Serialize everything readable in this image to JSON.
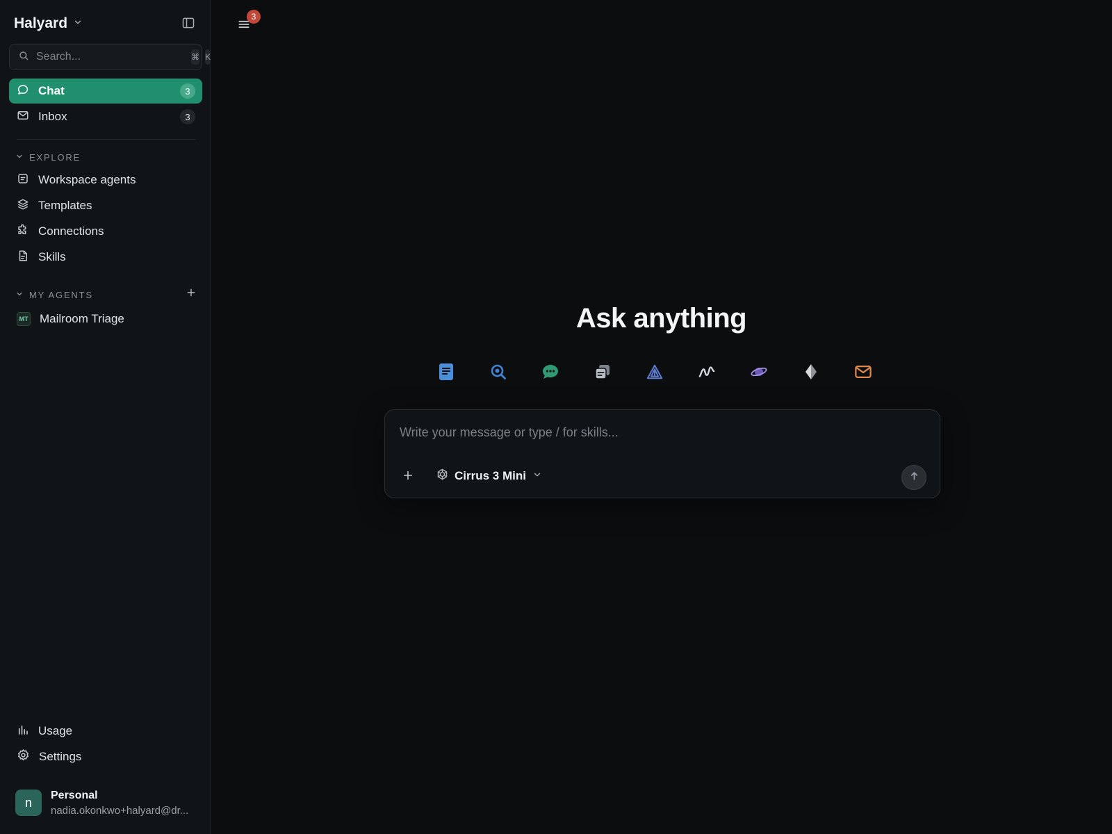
{
  "workspace": {
    "name": "Halyard"
  },
  "search": {
    "placeholder": "Search...",
    "shortcut_mod": "⌘",
    "shortcut_key": "K"
  },
  "nav": [
    {
      "label": "Chat",
      "count": "3",
      "icon": "chat-bubble-icon",
      "active": true
    },
    {
      "label": "Inbox",
      "count": "3",
      "icon": "mail-icon",
      "active": false
    }
  ],
  "explore": {
    "title": "EXPLORE",
    "items": [
      {
        "label": "Workspace agents",
        "icon": "agent-icon"
      },
      {
        "label": "Templates",
        "icon": "layers-icon"
      },
      {
        "label": "Connections",
        "icon": "puzzle-icon"
      },
      {
        "label": "Skills",
        "icon": "document-icon"
      }
    ]
  },
  "my_agents": {
    "title": "MY AGENTS",
    "items": [
      {
        "label": "Mailroom Triage",
        "initials": "MT"
      }
    ]
  },
  "footer": {
    "usage": "Usage",
    "settings": "Settings",
    "profile": {
      "name": "Personal",
      "email": "nadia.okonkwo+halyard@dr...",
      "initial": "n"
    }
  },
  "main": {
    "notifications": "3",
    "headline": "Ask anything",
    "tools": [
      "docs-icon",
      "search-icon",
      "chat-icon",
      "notes-icon",
      "triangle-icon",
      "signal-icon",
      "planet-icon",
      "diamond-icon",
      "mail-icon"
    ],
    "composer": {
      "placeholder": "Write your message or type / for skills...",
      "model": "Cirrus 3 Mini"
    }
  },
  "colors": {
    "accent": "#1f8f6d",
    "badge": "#c2493a",
    "background": "#0b0d0f",
    "sidebar": "#111417"
  }
}
